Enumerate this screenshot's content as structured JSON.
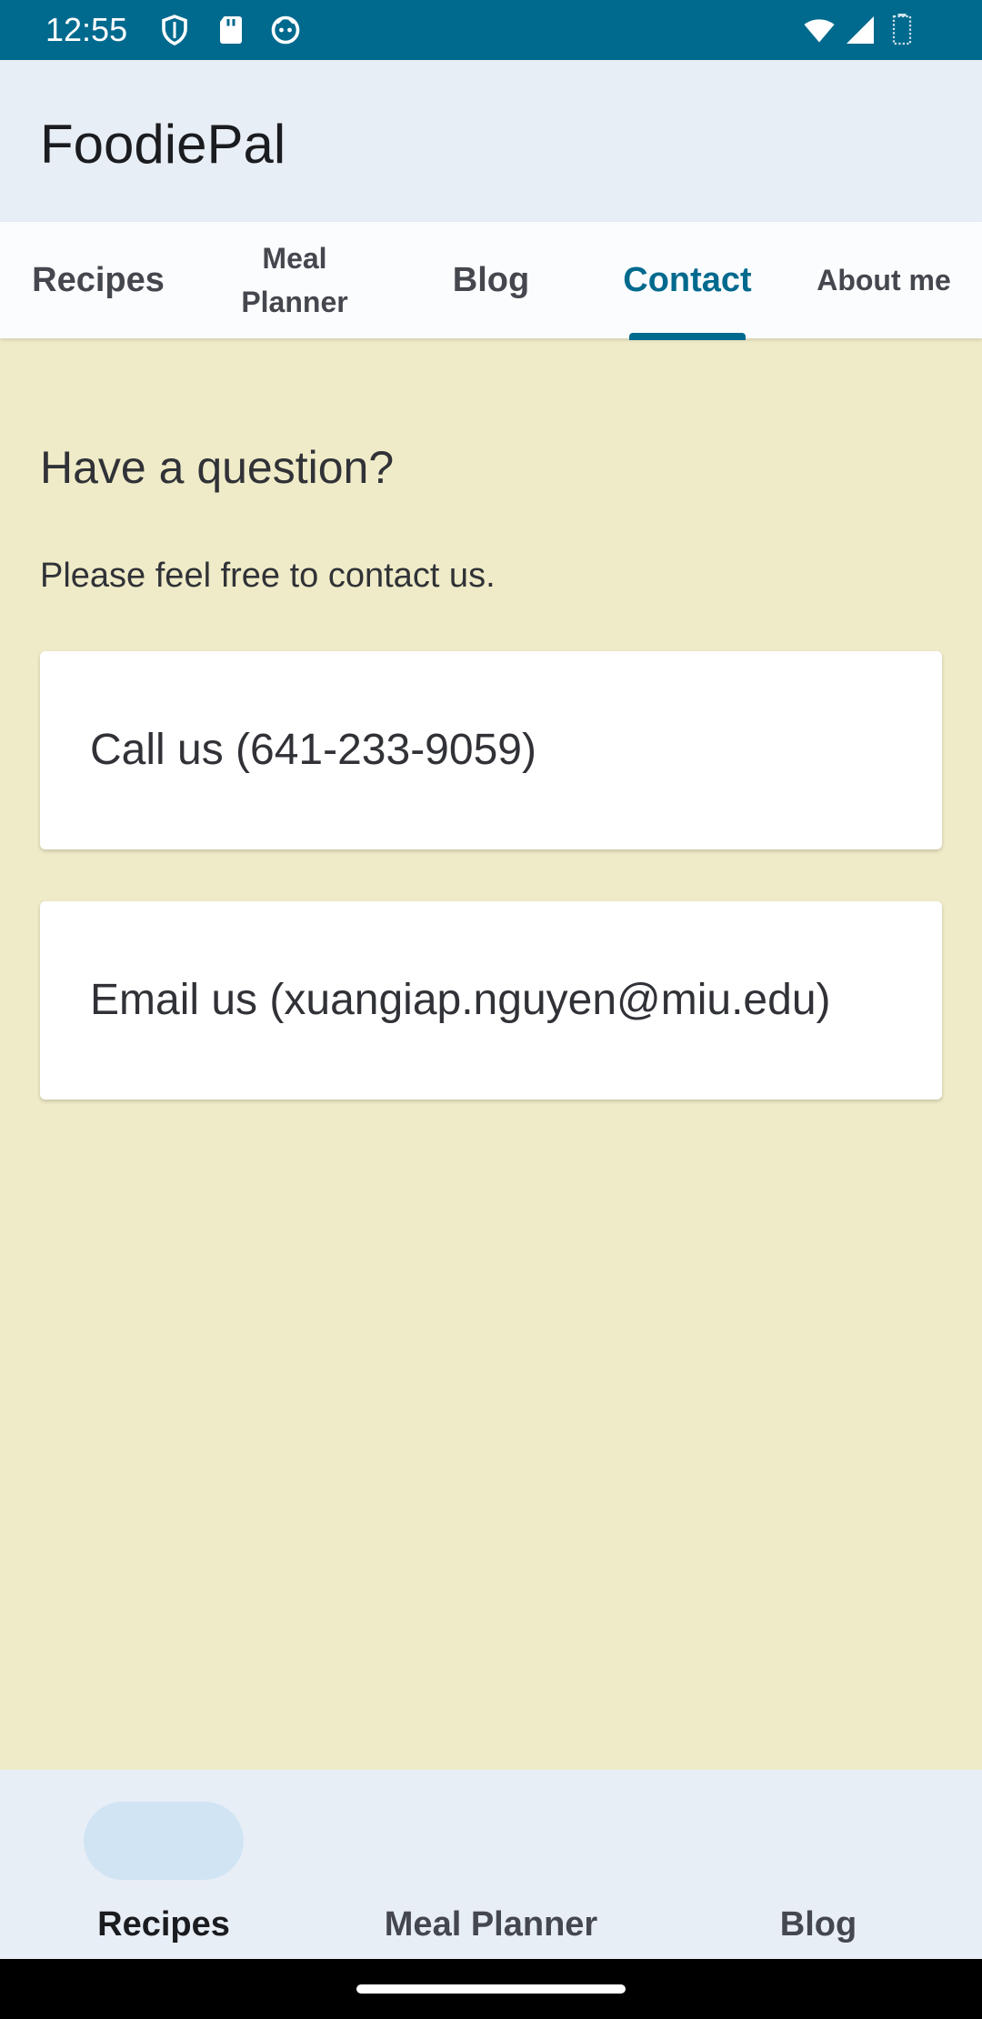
{
  "status_bar": {
    "time": "12:55"
  },
  "app": {
    "title": "FoodiePal"
  },
  "tabs": [
    {
      "label": "Recipes"
    },
    {
      "label_line1": "Meal",
      "label_line2": "Planner"
    },
    {
      "label": "Blog"
    },
    {
      "label": "Contact",
      "active": true
    },
    {
      "label": "About me"
    }
  ],
  "contact": {
    "heading": "Have a question?",
    "subtext": "Please feel free to contact us.",
    "call_label": "Call us (641-233-9059)",
    "email_label": "Email us (xuangiap.nguyen@miu.edu)"
  },
  "bottom_nav": {
    "items": [
      {
        "label": "Recipes",
        "active": true
      },
      {
        "label": "Meal Planner"
      },
      {
        "label": "Blog"
      }
    ]
  },
  "colors": {
    "status_bar": "#006a8e",
    "accent": "#006a8e",
    "content_background": "#efebc8",
    "app_bar": "#e8eef6"
  }
}
